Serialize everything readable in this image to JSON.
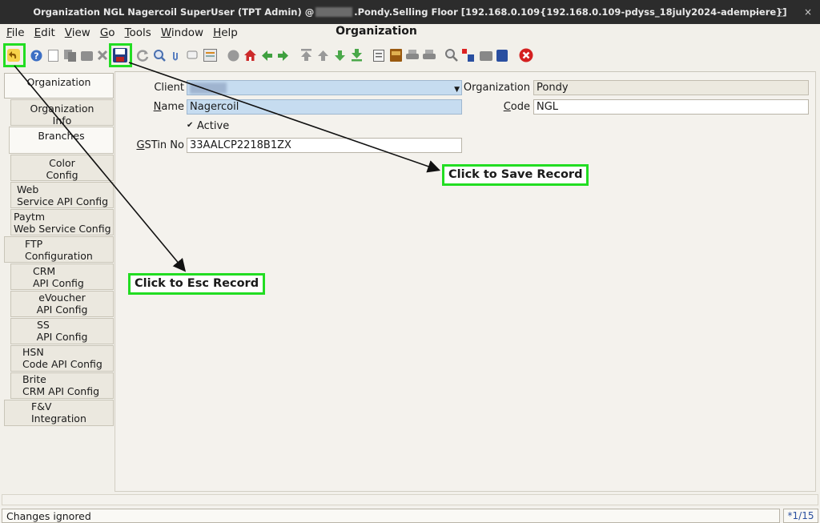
{
  "titlebar": {
    "text_left": "Organization  NGL  Nagercoil  SuperUser (TPT Admin) @",
    "text_right": ".Pondy.Selling Floor [192.168.0.109{192.168.0.109-pdyss_18july2024-adempiere}]",
    "minimize": "–",
    "maximize": "□",
    "close": "×"
  },
  "menu": [
    "File",
    "Edit",
    "View",
    "Go",
    "Tools",
    "Window",
    "Help"
  ],
  "window_title": "Organization",
  "toolbar": {
    "icons": [
      "undo-icon",
      "help-icon",
      "new-record-icon",
      "copy-record-icon",
      "delete-icon",
      "delete-selection-icon",
      "save-icon",
      "refresh-icon",
      "find-icon",
      "attachment-icon",
      "chat-icon",
      "multi-view-icon",
      "history-icon",
      "home-icon",
      "back-icon",
      "forward-icon",
      "first-record-icon",
      "previous-record-icon",
      "next-record-icon",
      "last-record-icon",
      "report-icon",
      "archive-icon",
      "print-preview-icon",
      "print-icon",
      "zoom-across-icon",
      "request-icon",
      "product-info-icon",
      "active-workflows-icon",
      "end-window-icon"
    ]
  },
  "tabs": [
    {
      "label_1": "Organization",
      "label_2": ""
    },
    {
      "label_1": "Organization",
      "label_2": "Info"
    },
    {
      "label_1": "Branches",
      "label_2": ""
    },
    {
      "label_1": "Color",
      "label_2": "Config"
    },
    {
      "label_1": "Web",
      "label_2": "Service API Config"
    },
    {
      "label_1": "Paytm",
      "label_2": "Web Service Config"
    },
    {
      "label_1": "FTP",
      "label_2": "Configuration"
    },
    {
      "label_1": "CRM",
      "label_2": "API Config"
    },
    {
      "label_1": "eVoucher",
      "label_2": "API Config"
    },
    {
      "label_1": "SS",
      "label_2": "API Config"
    },
    {
      "label_1": "HSN",
      "label_2": "Code API Config"
    },
    {
      "label_1": "Brite",
      "label_2": "CRM API Config"
    },
    {
      "label_1": "F&V",
      "label_2": "Integration"
    }
  ],
  "form": {
    "client_label": "Client",
    "client_value": "",
    "organization_label": "Organization",
    "organization_value": "Pondy",
    "name_label_first": "N",
    "name_label_rest": "ame",
    "name_value": "Nagercoil",
    "code_label_first": "C",
    "code_label_rest": "ode",
    "code_value": "NGL",
    "active_check": "✔",
    "active_label": "Active",
    "gstin_label_first": "G",
    "gstin_label_rest": "STin No",
    "gstin_value": "33AALCP2218B1ZX"
  },
  "callouts": {
    "save": "Click to Save Record",
    "esc": "Click to Esc Record"
  },
  "status": {
    "text": "Changes ignored",
    "record_count": "*1/15"
  },
  "colors": {
    "highlight": "#22dd22",
    "titlebar_bg": "#2c2c2c",
    "required_field": "#c6dcf0"
  }
}
